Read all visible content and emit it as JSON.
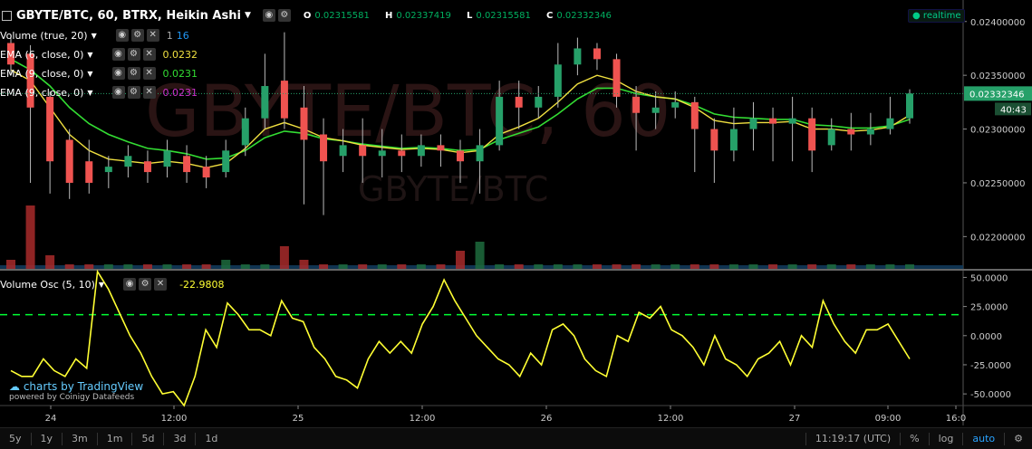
{
  "header": {
    "symbol_title": "GBYTE/BTC, 60, BTRX, Heikin Ashi",
    "ohlc": [
      {
        "key": "O",
        "value": "0.02315581"
      },
      {
        "key": "H",
        "value": "0.02337419"
      },
      {
        "key": "L",
        "value": "0.02315581"
      },
      {
        "key": "C",
        "value": "0.02332346"
      }
    ],
    "realtime": "realtime"
  },
  "indicators": [
    {
      "label": "Volume (true, 20)",
      "values": [
        "1",
        "16"
      ],
      "colors": [
        "#aaaaaa",
        "#2196f3"
      ]
    },
    {
      "label": "EMA (6, close, 0)",
      "values": [
        "0.0232"
      ],
      "colors": [
        "#f0e040"
      ]
    },
    {
      "label": "EMA (9, close, 0)",
      "values": [
        "0.0231"
      ],
      "colors": [
        "#33dd33"
      ]
    },
    {
      "label": "EMA (9, close, 0)",
      "values": [
        "0.0231"
      ],
      "colors": [
        "#cc33cc"
      ]
    }
  ],
  "watermark": {
    "big": "GBYTE/BTC, 60",
    "small": "GBYTE/BTC"
  },
  "price_axis": {
    "ticks": [
      "0.02400000",
      "0.02350000",
      "0.02300000",
      "0.02250000",
      "0.02200000"
    ],
    "current_price": "0.02332346",
    "countdown": "40:43"
  },
  "oscillator": {
    "label": "Volume Osc (5, 10)",
    "value": "-22.9808",
    "ticks": [
      "50.0000",
      "25.0000",
      "0.0000",
      "-25.0000",
      "-50.0000"
    ]
  },
  "time_axis": [
    "24",
    "12:00",
    "25",
    "12:00",
    "26",
    "12:00",
    "27",
    "09:00",
    "16:0"
  ],
  "branding": {
    "line1": "charts by TradingView",
    "line2": "powered by Coinigy Datafeeds"
  },
  "bottom_bar": {
    "timeframes": [
      "5y",
      "1y",
      "3m",
      "1m",
      "5d",
      "3d",
      "1d"
    ],
    "clock": "11:19:17 (UTC)",
    "percent": "%",
    "log": "log",
    "auto": "auto"
  },
  "colors": {
    "up": "#26a069",
    "down": "#ef5350",
    "ema_fast": "#f0e040",
    "ema_slow": "#33dd33",
    "osc": "#ffff33",
    "osc_ref": "#00ff33"
  },
  "chart_data": [
    {
      "type": "candlestick",
      "title": "GBYTE/BTC, 60, BTRX, Heikin Ashi",
      "y_range": [
        0.0217,
        0.0242
      ],
      "candles": [
        {
          "o": 0.0238,
          "c": 0.0236,
          "h": 0.02388,
          "l": 0.0235
        },
        {
          "o": 0.0237,
          "c": 0.0232,
          "h": 0.02378,
          "l": 0.0225
        },
        {
          "o": 0.0233,
          "c": 0.0227,
          "h": 0.02335,
          "l": 0.0224
        },
        {
          "o": 0.0229,
          "c": 0.0225,
          "h": 0.023,
          "l": 0.02235
        },
        {
          "o": 0.0227,
          "c": 0.0225,
          "h": 0.0229,
          "l": 0.0224
        },
        {
          "o": 0.0226,
          "c": 0.02265,
          "h": 0.02275,
          "l": 0.02245
        },
        {
          "o": 0.02265,
          "c": 0.02275,
          "h": 0.02285,
          "l": 0.02255
        },
        {
          "o": 0.0227,
          "c": 0.0226,
          "h": 0.0228,
          "l": 0.0225
        },
        {
          "o": 0.02265,
          "c": 0.0228,
          "h": 0.0229,
          "l": 0.02255
        },
        {
          "o": 0.02275,
          "c": 0.0226,
          "h": 0.02285,
          "l": 0.0225
        },
        {
          "o": 0.02265,
          "c": 0.02255,
          "h": 0.02275,
          "l": 0.02245
        },
        {
          "o": 0.0226,
          "c": 0.0228,
          "h": 0.0229,
          "l": 0.02255
        },
        {
          "o": 0.02285,
          "c": 0.0231,
          "h": 0.0232,
          "l": 0.02275
        },
        {
          "o": 0.0231,
          "c": 0.0234,
          "h": 0.0237,
          "l": 0.023
        },
        {
          "o": 0.02345,
          "c": 0.0231,
          "h": 0.0239,
          "l": 0.023
        },
        {
          "o": 0.0232,
          "c": 0.0229,
          "h": 0.0234,
          "l": 0.0223
        },
        {
          "o": 0.02295,
          "c": 0.0227,
          "h": 0.0231,
          "l": 0.0222
        },
        {
          "o": 0.02275,
          "c": 0.02285,
          "h": 0.023,
          "l": 0.0226
        },
        {
          "o": 0.02285,
          "c": 0.02275,
          "h": 0.0231,
          "l": 0.0225
        },
        {
          "o": 0.02275,
          "c": 0.0228,
          "h": 0.023,
          "l": 0.02255
        },
        {
          "o": 0.0228,
          "c": 0.02275,
          "h": 0.02295,
          "l": 0.0226
        },
        {
          "o": 0.02275,
          "c": 0.02285,
          "h": 0.02295,
          "l": 0.02265
        },
        {
          "o": 0.02285,
          "c": 0.0228,
          "h": 0.02295,
          "l": 0.02265
        },
        {
          "o": 0.0228,
          "c": 0.0227,
          "h": 0.0229,
          "l": 0.0225
        },
        {
          "o": 0.0227,
          "c": 0.02285,
          "h": 0.023,
          "l": 0.0224
        },
        {
          "o": 0.02285,
          "c": 0.0233,
          "h": 0.02345,
          "l": 0.0228
        },
        {
          "o": 0.0233,
          "c": 0.0232,
          "h": 0.02345,
          "l": 0.023
        },
        {
          "o": 0.0232,
          "c": 0.0233,
          "h": 0.0234,
          "l": 0.0231
        },
        {
          "o": 0.0233,
          "c": 0.0236,
          "h": 0.0238,
          "l": 0.0232
        },
        {
          "o": 0.0236,
          "c": 0.02375,
          "h": 0.02385,
          "l": 0.0235
        },
        {
          "o": 0.02375,
          "c": 0.02365,
          "h": 0.0238,
          "l": 0.02355
        },
        {
          "o": 0.02365,
          "c": 0.0233,
          "h": 0.0237,
          "l": 0.0232
        },
        {
          "o": 0.0233,
          "c": 0.02315,
          "h": 0.0234,
          "l": 0.0228
        },
        {
          "o": 0.02315,
          "c": 0.0232,
          "h": 0.02335,
          "l": 0.023
        },
        {
          "o": 0.0232,
          "c": 0.02325,
          "h": 0.02335,
          "l": 0.0231
        },
        {
          "o": 0.02325,
          "c": 0.023,
          "h": 0.0233,
          "l": 0.0226
        },
        {
          "o": 0.023,
          "c": 0.0228,
          "h": 0.0231,
          "l": 0.0225
        },
        {
          "o": 0.0228,
          "c": 0.023,
          "h": 0.0232,
          "l": 0.0227
        },
        {
          "o": 0.023,
          "c": 0.0231,
          "h": 0.02325,
          "l": 0.0228
        },
        {
          "o": 0.0231,
          "c": 0.02305,
          "h": 0.0232,
          "l": 0.0227
        },
        {
          "o": 0.02305,
          "c": 0.0231,
          "h": 0.0233,
          "l": 0.0227
        },
        {
          "o": 0.0231,
          "c": 0.0228,
          "h": 0.0232,
          "l": 0.0226
        },
        {
          "o": 0.02285,
          "c": 0.023,
          "h": 0.0231,
          "l": 0.0228
        },
        {
          "o": 0.023,
          "c": 0.02295,
          "h": 0.02315,
          "l": 0.0228
        },
        {
          "o": 0.02295,
          "c": 0.023,
          "h": 0.02315,
          "l": 0.02285
        },
        {
          "o": 0.023,
          "c": 0.0231,
          "h": 0.0233,
          "l": 0.02295
        },
        {
          "o": 0.0231,
          "c": 0.02333,
          "h": 0.02337,
          "l": 0.02305
        }
      ],
      "ema_fast": [
        0.02355,
        0.02345,
        0.0232,
        0.02295,
        0.0228,
        0.02272,
        0.0227,
        0.02268,
        0.0227,
        0.02268,
        0.02264,
        0.02268,
        0.02282,
        0.023,
        0.02306,
        0.023,
        0.02292,
        0.02289,
        0.02285,
        0.02283,
        0.02281,
        0.02282,
        0.02281,
        0.02278,
        0.0228,
        0.02295,
        0.02302,
        0.0231,
        0.02325,
        0.02342,
        0.0235,
        0.02345,
        0.02335,
        0.0233,
        0.02328,
        0.0232,
        0.02308,
        0.02305,
        0.02306,
        0.02306,
        0.02307,
        0.023,
        0.023,
        0.02298,
        0.02299,
        0.02302,
        0.02313
      ],
      "ema_slow": [
        0.02365,
        0.02355,
        0.0234,
        0.0232,
        0.02305,
        0.02295,
        0.02288,
        0.02282,
        0.0228,
        0.02277,
        0.02272,
        0.02273,
        0.0228,
        0.02292,
        0.02298,
        0.02296,
        0.02291,
        0.02289,
        0.02286,
        0.02284,
        0.02282,
        0.02283,
        0.02282,
        0.0228,
        0.02281,
        0.0229,
        0.02296,
        0.02302,
        0.02314,
        0.02328,
        0.02338,
        0.02338,
        0.02333,
        0.0233,
        0.02328,
        0.02322,
        0.02314,
        0.02311,
        0.0231,
        0.02309,
        0.02309,
        0.02304,
        0.02303,
        0.02301,
        0.02301,
        0.02303,
        0.02309
      ],
      "volume": [
        2,
        14,
        3,
        1,
        1,
        1,
        1,
        1,
        1,
        1,
        1,
        2,
        1,
        1,
        5,
        2,
        1,
        1,
        1,
        1,
        1,
        1,
        1,
        4,
        6,
        1,
        1,
        1,
        1,
        1,
        1,
        1,
        1,
        1,
        1,
        1,
        1,
        1,
        1,
        1,
        1,
        1,
        1,
        1,
        1,
        1,
        1
      ]
    },
    {
      "type": "line",
      "title": "Volume Osc (5, 10)",
      "y_range": [
        -60,
        55
      ],
      "reference_line": 18,
      "values": [
        -30,
        -35,
        -35,
        -20,
        -30,
        -35,
        -20,
        -28,
        55,
        40,
        20,
        0,
        -15,
        -35,
        -50,
        -48,
        -60,
        -35,
        5,
        -10,
        28,
        18,
        5,
        5,
        0,
        30,
        15,
        12,
        -10,
        -20,
        -35,
        -38,
        -45,
        -20,
        -5,
        -15,
        -5,
        -15,
        10,
        25,
        48,
        30,
        15,
        0,
        -10,
        -20,
        -25,
        -35,
        -15,
        -25,
        5,
        10,
        0,
        -20,
        -30,
        -35,
        0,
        -5,
        20,
        15,
        25,
        5,
        0,
        -10,
        -25,
        0,
        -20,
        -25,
        -35,
        -20,
        -15,
        -5,
        -25,
        0,
        -10,
        30,
        10,
        -5,
        -15,
        5,
        5,
        10,
        -5,
        -20
      ],
      "last_value": -22.9808
    }
  ]
}
